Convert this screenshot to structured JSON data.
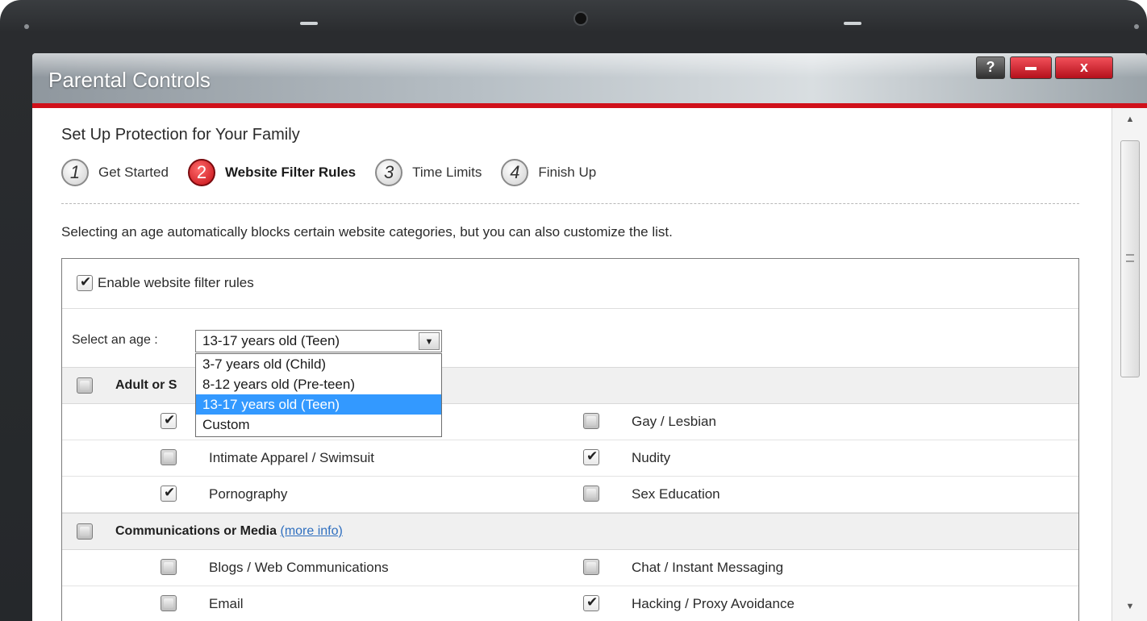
{
  "window": {
    "title": "Parental Controls",
    "help_label": "?",
    "close_label": "x"
  },
  "setup": {
    "heading": "Set Up Protection for Your Family",
    "steps": [
      {
        "number": "1",
        "label": "Get Started",
        "active": false
      },
      {
        "number": "2",
        "label": "Website Filter Rules",
        "active": true
      },
      {
        "number": "3",
        "label": "Time Limits",
        "active": false
      },
      {
        "number": "4",
        "label": "Finish Up",
        "active": false
      }
    ],
    "intro": "Selecting an age automatically blocks certain website categories, but you can also customize the list."
  },
  "filter": {
    "enable_label": "Enable website filter rules",
    "enable_checked": true,
    "age_label": "Select an age :",
    "age_selected": "13-17 years old (Teen)",
    "age_options": [
      "3-7 years old (Child)",
      "8-12 years old (Pre-teen)",
      "13-17 years old (Teen)",
      "Custom"
    ],
    "age_selected_index": 2
  },
  "categories": [
    {
      "name": "Adult or Sexual",
      "visible_name": "Adult or S",
      "more_info": "",
      "items": [
        {
          "label": "",
          "checked": true
        },
        {
          "label": "Gay / Lesbian",
          "checked": false
        },
        {
          "label": "Intimate Apparel / Swimsuit",
          "checked": false
        },
        {
          "label": "Nudity",
          "checked": true
        },
        {
          "label": "Pornography",
          "checked": true
        },
        {
          "label": "Sex Education",
          "checked": false
        }
      ]
    },
    {
      "name": "Communications or Media",
      "more_info": "(more info)",
      "items": [
        {
          "label": "Blogs / Web Communications",
          "checked": false
        },
        {
          "label": "Chat / Instant Messaging",
          "checked": false
        },
        {
          "label": "Email",
          "checked": false
        },
        {
          "label": "Hacking / Proxy Avoidance",
          "checked": true
        }
      ]
    }
  ],
  "colors": {
    "accent_red": "#d0101a",
    "selection_blue": "#3399ff",
    "link_blue": "#2f6fbf"
  },
  "icons": {
    "check": "✔",
    "dropdown_arrow": "▼",
    "scroll_up": "▲",
    "scroll_down": "▼"
  }
}
